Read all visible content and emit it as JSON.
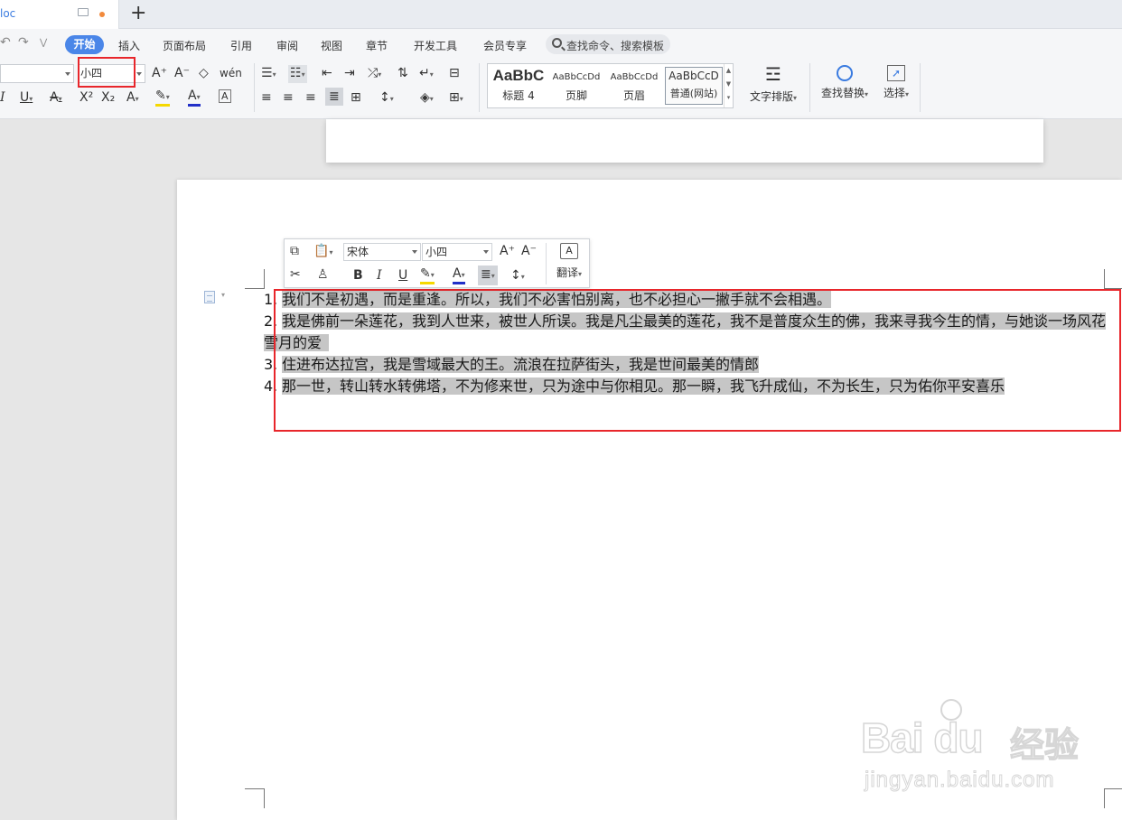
{
  "tab": {
    "doc_name": "loc"
  },
  "newtab_label": "+",
  "menu": {
    "items": [
      "开始",
      "插入",
      "页面布局",
      "引用",
      "审阅",
      "视图",
      "章节",
      "开发工具",
      "会员专享"
    ],
    "search_placeholder": "查找命令、搜索模板",
    "quick_access": [
      "↶",
      "↷",
      "⋁"
    ]
  },
  "ribbon": {
    "font_size": "小四",
    "style_gallery": [
      {
        "preview": "AaBbC",
        "name": "标题 4"
      },
      {
        "preview": "AaBbCcDd",
        "name": "页脚"
      },
      {
        "preview": "AaBbCcDd",
        "name": "页眉"
      },
      {
        "preview": "AaBbCcD",
        "name": "普通(网站)"
      }
    ],
    "text_layout_label": "文字排版",
    "find_replace_label": "查找替换",
    "select_label": "选择",
    "icons": {
      "grow": "A⁺",
      "shrink": "A⁻",
      "clear": "◇",
      "phonetic": "wén",
      "italic": "I",
      "underline": "U",
      "strike": "A",
      "sup": "X²",
      "sub": "X₂",
      "effect": "A",
      "highlight": "✎",
      "fontcolor": "A",
      "charborder": "A"
    }
  },
  "mini_toolbar": {
    "font_name": "宋体",
    "font_size": "小四",
    "translate_label": "翻译",
    "bold": "B",
    "italic": "I",
    "underline": "U",
    "fontcolor": "A"
  },
  "document": {
    "items": [
      {
        "num": "1.",
        "text": "我们不是初遇，而是重逢。所以，我们不必害怕别离，也不必担心一撇手就不会相遇。"
      },
      {
        "num": "2.",
        "text": "我是佛前一朵莲花，我到人世来，被世人所误。我是凡尘最美的莲花，我不是普度众生的佛，我来寻我今生的情，与她谈一场风花",
        "text2": "雪月的爱"
      },
      {
        "num": "3.",
        "text": "住进布达拉宫，我是雪域最大的王。流浪在拉萨街头，我是世间最美的情郎"
      },
      {
        "num": "4.",
        "text": "那一世，转山转水转佛塔，不为修来世，只为途中与你相见。那一瞬，我飞升成仙，不为长生，只为佑你平安喜乐"
      }
    ]
  },
  "watermark": {
    "brand": "Bai du",
    "label": "经验",
    "url": "jingyan.baidu.com"
  },
  "colors": {
    "accent": "#4a86e8",
    "annotation": "#e8262b",
    "selection": "#c6c6c6"
  }
}
